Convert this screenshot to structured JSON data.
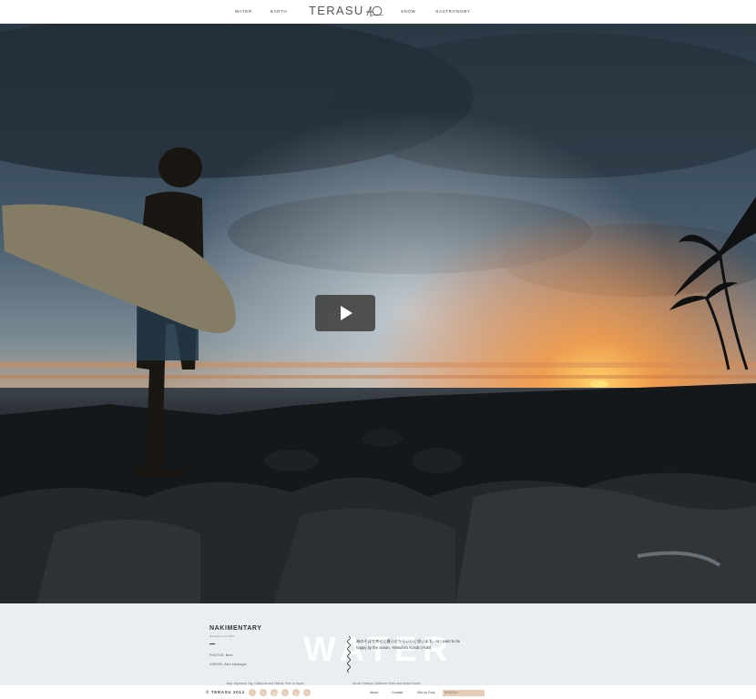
{
  "nav": {
    "left": [
      "WATER",
      "EARTH"
    ],
    "logo": "TERASU",
    "logo_mark": "40",
    "right": [
      "SNOW",
      "GASTRONOMY"
    ]
  },
  "hero": {
    "play_icon": "play-icon",
    "colors": {
      "sky": "#3a4a57",
      "sun": "#ff9b3a",
      "rocks": "#141619"
    }
  },
  "info": {
    "title": "NAKIMENTARY",
    "date": "December 1st, 2014",
    "photo_credit": "PHOTOS: Nuts",
    "video_credit": "VIDEOS: Alex Kanbagai",
    "background_word": "WATER",
    "quote": "海のそばで幸せに暮らせたらいいと思います。AI | want to be happy by the ocean. -Mitsuhiro Kondo (Yuki)",
    "tags_left": "Jeep   Japanese   Tag:   California   and   Hawaii,   Dive   to   Japan",
    "tags_right": "Nicole Kaalepa California Video and Award Noted"
  },
  "footer": {
    "copyright": "© TERASU 2014",
    "social": [
      "facebook-icon",
      "twitter-icon",
      "instagram-icon",
      "vimeo-icon",
      "pinterest-icon",
      "rss-icon"
    ],
    "links": [
      "About",
      "Contact",
      "Site by Grey"
    ],
    "search_placeholder": "SEARCH",
    "accent": "#e7cdb8"
  }
}
